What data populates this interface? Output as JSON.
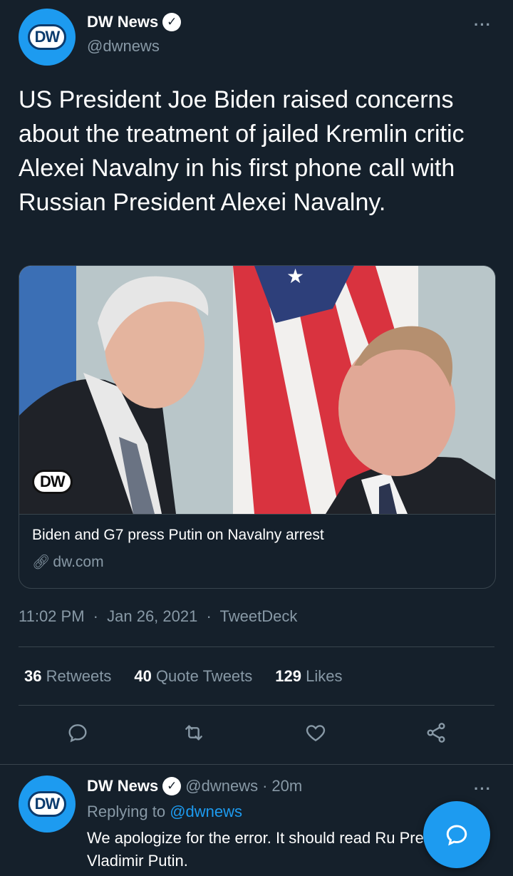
{
  "tweet": {
    "avatar_logo": "DW",
    "name": "DW News",
    "handle": "@dwnews",
    "more": "···",
    "text": "US President Joe Biden raised concerns about the treatment of jailed Kremlin critic Alexei Navalny in his first phone call with Russian President Alexei Navalny.",
    "card": {
      "image_logo": "DW",
      "title": "Biden and G7 press Putin on Navalny arrest",
      "domain": "dw.com"
    },
    "time": "11:02 PM",
    "date": "Jan 26, 2021",
    "source": "TweetDeck",
    "sep": "·"
  },
  "stats": {
    "retweets_count": "36",
    "retweets_label": "Retweets",
    "quotes_count": "40",
    "quotes_label": "Quote Tweets",
    "likes_count": "129",
    "likes_label": "Likes"
  },
  "actions": {
    "icons": [
      "reply-icon",
      "retweet-icon",
      "like-icon",
      "share-icon"
    ]
  },
  "reply": {
    "avatar_logo": "DW",
    "name": "DW News",
    "handle": "@dwnews",
    "dot": "·",
    "time": "20m",
    "more": "···",
    "replying_prefix": "Replying to",
    "replying_mention": "@dwnews",
    "text": "We apologize for the error. It should read Ru President Vladimir Putin."
  },
  "colors": {
    "background": "#15202b",
    "accent": "#1d9bf0",
    "muted": "#8899a6",
    "border": "#38444d"
  }
}
